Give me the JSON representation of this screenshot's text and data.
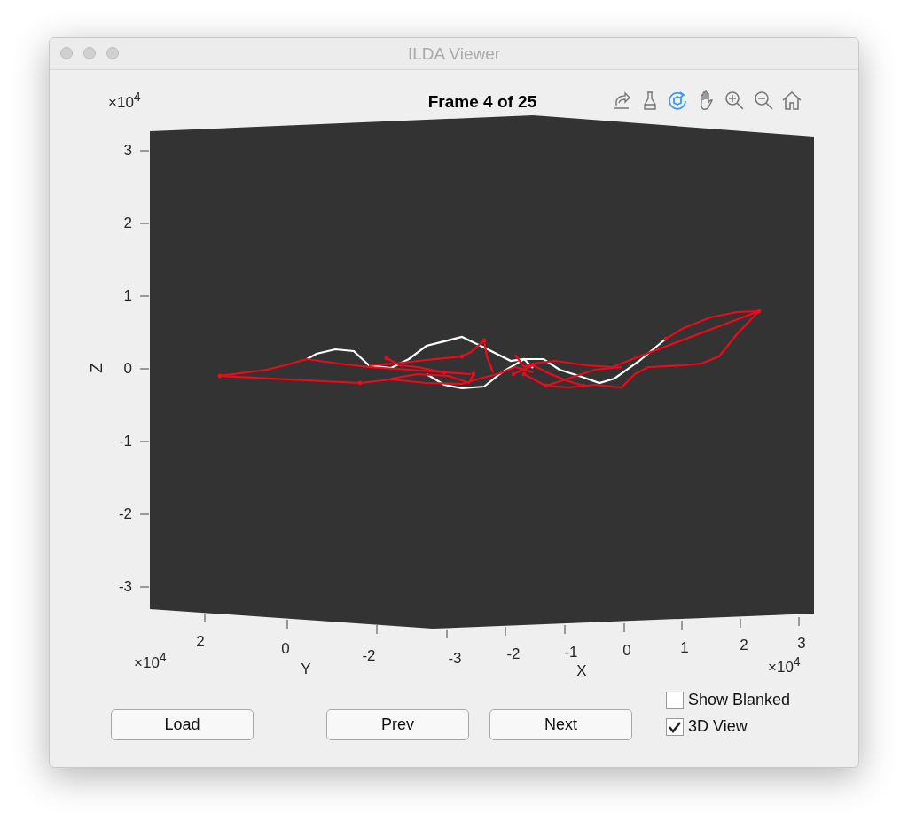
{
  "window": {
    "title": "ILDA Viewer"
  },
  "figure": {
    "title": "Frame 4 of 25",
    "z_axis": {
      "label": "Z",
      "exponent": "×10$^{4}$",
      "ticks": [
        "3",
        "2",
        "1",
        "0",
        "-1",
        "-2",
        "-3"
      ]
    },
    "y_axis": {
      "label": "Y",
      "exponent": "×10$^{4}$",
      "ticks": [
        "2",
        "0",
        "-2"
      ]
    },
    "x_axis": {
      "label": "X",
      "exponent": "×10$^{4}$",
      "ticks": [
        "-3",
        "-2",
        "-1",
        "0",
        "1",
        "2",
        "3"
      ]
    },
    "rotate_tool": {
      "selected": true
    }
  },
  "buttons": [
    {
      "label": "Load"
    },
    {
      "label": "Prev"
    },
    {
      "label": "Next"
    }
  ],
  "checkboxes": [
    {
      "label": "Show Blanked",
      "checked": false
    },
    {
      "label": "3D View",
      "checked": true
    }
  ]
}
